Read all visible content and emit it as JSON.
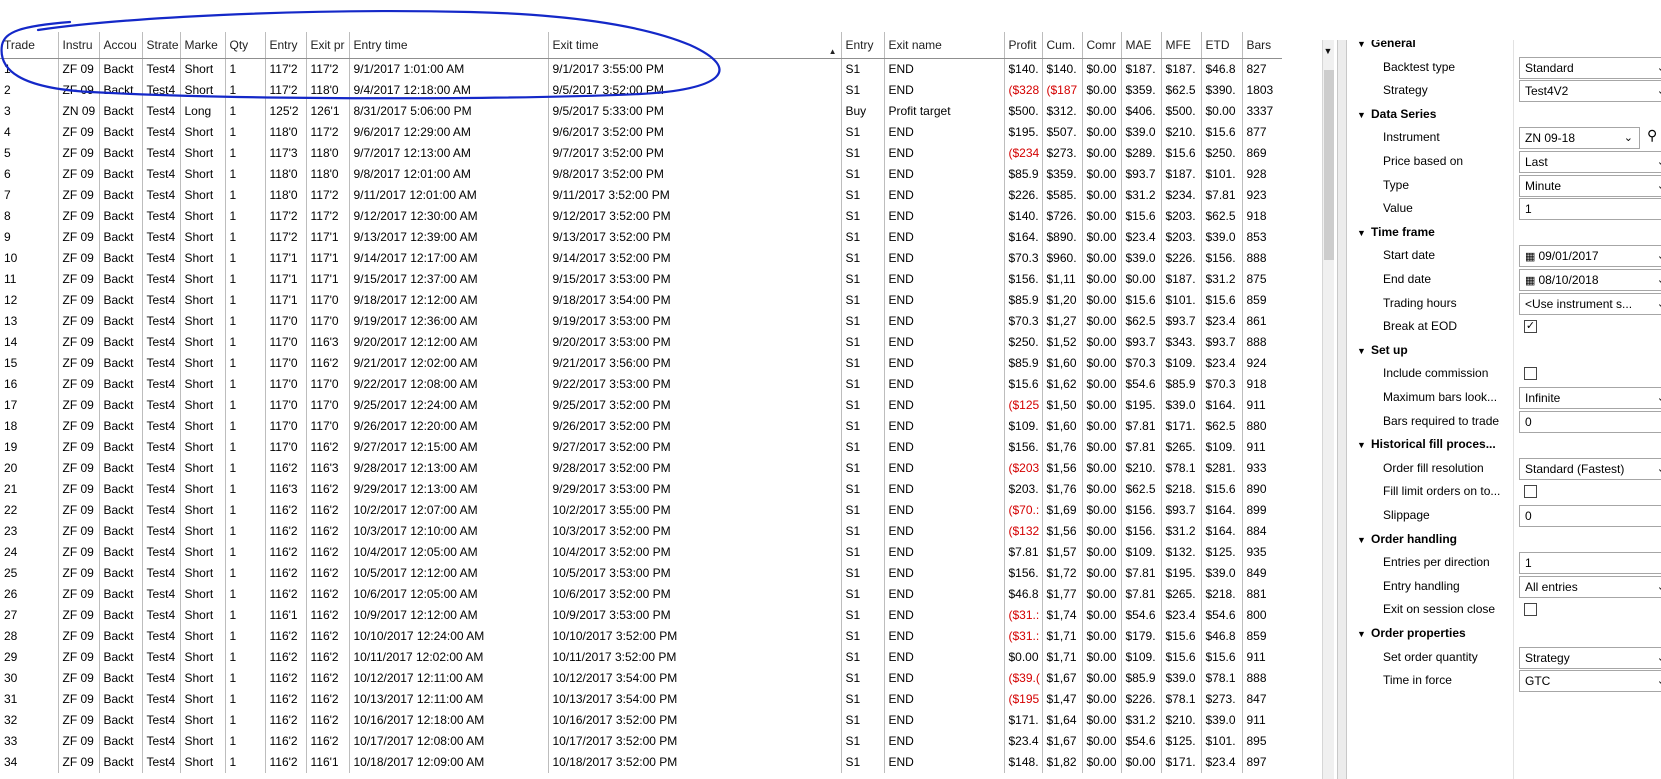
{
  "grid": {
    "columns": [
      {
        "label": "Trade",
        "w": 58
      },
      {
        "label": "Instru",
        "w": 41
      },
      {
        "label": "Accou",
        "w": 43
      },
      {
        "label": "Strate",
        "w": 38
      },
      {
        "label": "Marke",
        "w": 45
      },
      {
        "label": "Qty",
        "w": 40
      },
      {
        "label": "Entry",
        "w": 41
      },
      {
        "label": "Exit pr",
        "w": 43
      },
      {
        "label": "Entry time",
        "w": 199
      },
      {
        "label": "Exit time",
        "w": 293
      },
      {
        "label": "Entry",
        "w": 43
      },
      {
        "label": "Exit name",
        "w": 120
      },
      {
        "label": "Profit",
        "w": 38
      },
      {
        "label": "Cum.",
        "w": 40
      },
      {
        "label": "Comr",
        "w": 39
      },
      {
        "label": "MAE",
        "w": 40
      },
      {
        "label": "MFE",
        "w": 40
      },
      {
        "label": "ETD",
        "w": 41
      },
      {
        "label": "Bars",
        "w": 40
      }
    ],
    "sorted_column_index": 9,
    "sort_arrow": "▲",
    "rows": [
      [
        "1",
        "ZF 09",
        "Backt",
        "Test4",
        "Short",
        "1",
        "117'2",
        "117'2",
        "9/1/2017 1:01:00 AM",
        "9/1/2017 3:55:00 PM",
        "S1",
        "END",
        "$140.",
        "$140.",
        "$0.00",
        "$187.",
        "$187.",
        "$46.8",
        "827"
      ],
      [
        "2",
        "ZF 09",
        "Backt",
        "Test4",
        "Short",
        "1",
        "117'2",
        "118'0",
        "9/4/2017 12:18:00 AM",
        "9/5/2017 3:52:00 PM",
        "S1",
        "END",
        "($328",
        "($187",
        "$0.00",
        "$359.",
        "$62.5",
        "$390.",
        "1803"
      ],
      [
        "3",
        "ZN 09",
        "Backt",
        "Test4",
        "Long",
        "1",
        "125'2",
        "126'1",
        "8/31/2017 5:06:00 PM",
        "9/5/2017 5:33:00 PM",
        "Buy",
        "Profit target",
        "$500.",
        "$312.",
        "$0.00",
        "$406.",
        "$500.",
        "$0.00",
        "3337"
      ],
      [
        "4",
        "ZF 09",
        "Backt",
        "Test4",
        "Short",
        "1",
        "118'0",
        "117'2",
        "9/6/2017 12:29:00 AM",
        "9/6/2017 3:52:00 PM",
        "S1",
        "END",
        "$195.",
        "$507.",
        "$0.00",
        "$39.0",
        "$210.",
        "$15.6",
        "877"
      ],
      [
        "5",
        "ZF 09",
        "Backt",
        "Test4",
        "Short",
        "1",
        "117'3",
        "118'0",
        "9/7/2017 12:13:00 AM",
        "9/7/2017 3:52:00 PM",
        "S1",
        "END",
        "($234",
        "$273.",
        "$0.00",
        "$289.",
        "$15.6",
        "$250.",
        "869"
      ],
      [
        "6",
        "ZF 09",
        "Backt",
        "Test4",
        "Short",
        "1",
        "118'0",
        "118'0",
        "9/8/2017 12:01:00 AM",
        "9/8/2017 3:52:00 PM",
        "S1",
        "END",
        "$85.9",
        "$359.",
        "$0.00",
        "$93.7",
        "$187.",
        "$101.",
        "928"
      ],
      [
        "7",
        "ZF 09",
        "Backt",
        "Test4",
        "Short",
        "1",
        "118'0",
        "117'2",
        "9/11/2017 12:01:00 AM",
        "9/11/2017 3:52:00 PM",
        "S1",
        "END",
        "$226.",
        "$585.",
        "$0.00",
        "$31.2",
        "$234.",
        "$7.81",
        "923"
      ],
      [
        "8",
        "ZF 09",
        "Backt",
        "Test4",
        "Short",
        "1",
        "117'2",
        "117'2",
        "9/12/2017 12:30:00 AM",
        "9/12/2017 3:52:00 PM",
        "S1",
        "END",
        "$140.",
        "$726.",
        "$0.00",
        "$15.6",
        "$203.",
        "$62.5",
        "918"
      ],
      [
        "9",
        "ZF 09",
        "Backt",
        "Test4",
        "Short",
        "1",
        "117'2",
        "117'1",
        "9/13/2017 12:39:00 AM",
        "9/13/2017 3:52:00 PM",
        "S1",
        "END",
        "$164.",
        "$890.",
        "$0.00",
        "$23.4",
        "$203.",
        "$39.0",
        "853"
      ],
      [
        "10",
        "ZF 09",
        "Backt",
        "Test4",
        "Short",
        "1",
        "117'1",
        "117'1",
        "9/14/2017 12:17:00 AM",
        "9/14/2017 3:52:00 PM",
        "S1",
        "END",
        "$70.3",
        "$960.",
        "$0.00",
        "$39.0",
        "$226.",
        "$156.",
        "888"
      ],
      [
        "11",
        "ZF 09",
        "Backt",
        "Test4",
        "Short",
        "1",
        "117'1",
        "117'1",
        "9/15/2017 12:37:00 AM",
        "9/15/2017 3:53:00 PM",
        "S1",
        "END",
        "$156.",
        "$1,11",
        "$0.00",
        "$0.00",
        "$187.",
        "$31.2",
        "875"
      ],
      [
        "12",
        "ZF 09",
        "Backt",
        "Test4",
        "Short",
        "1",
        "117'1",
        "117'0",
        "9/18/2017 12:12:00 AM",
        "9/18/2017 3:54:00 PM",
        "S1",
        "END",
        "$85.9",
        "$1,20",
        "$0.00",
        "$15.6",
        "$101.",
        "$15.6",
        "859"
      ],
      [
        "13",
        "ZF 09",
        "Backt",
        "Test4",
        "Short",
        "1",
        "117'0",
        "117'0",
        "9/19/2017 12:36:00 AM",
        "9/19/2017 3:53:00 PM",
        "S1",
        "END",
        "$70.3",
        "$1,27",
        "$0.00",
        "$62.5",
        "$93.7",
        "$23.4",
        "861"
      ],
      [
        "14",
        "ZF 09",
        "Backt",
        "Test4",
        "Short",
        "1",
        "117'0",
        "116'3",
        "9/20/2017 12:12:00 AM",
        "9/20/2017 3:53:00 PM",
        "S1",
        "END",
        "$250.",
        "$1,52",
        "$0.00",
        "$93.7",
        "$343.",
        "$93.7",
        "888"
      ],
      [
        "15",
        "ZF 09",
        "Backt",
        "Test4",
        "Short",
        "1",
        "117'0",
        "116'2",
        "9/21/2017 12:02:00 AM",
        "9/21/2017 3:56:00 PM",
        "S1",
        "END",
        "$85.9",
        "$1,60",
        "$0.00",
        "$70.3",
        "$109.",
        "$23.4",
        "924"
      ],
      [
        "16",
        "ZF 09",
        "Backt",
        "Test4",
        "Short",
        "1",
        "117'0",
        "117'0",
        "9/22/2017 12:08:00 AM",
        "9/22/2017 3:53:00 PM",
        "S1",
        "END",
        "$15.6",
        "$1,62",
        "$0.00",
        "$54.6",
        "$85.9",
        "$70.3",
        "918"
      ],
      [
        "17",
        "ZF 09",
        "Backt",
        "Test4",
        "Short",
        "1",
        "117'0",
        "117'0",
        "9/25/2017 12:24:00 AM",
        "9/25/2017 3:52:00 PM",
        "S1",
        "END",
        "($125",
        "$1,50",
        "$0.00",
        "$195.",
        "$39.0",
        "$164.",
        "911"
      ],
      [
        "18",
        "ZF 09",
        "Backt",
        "Test4",
        "Short",
        "1",
        "117'0",
        "117'0",
        "9/26/2017 12:20:00 AM",
        "9/26/2017 3:52:00 PM",
        "S1",
        "END",
        "$109.",
        "$1,60",
        "$0.00",
        "$7.81",
        "$171.",
        "$62.5",
        "880"
      ],
      [
        "19",
        "ZF 09",
        "Backt",
        "Test4",
        "Short",
        "1",
        "117'0",
        "116'2",
        "9/27/2017 12:15:00 AM",
        "9/27/2017 3:52:00 PM",
        "S1",
        "END",
        "$156.",
        "$1,76",
        "$0.00",
        "$7.81",
        "$265.",
        "$109.",
        "911"
      ],
      [
        "20",
        "ZF 09",
        "Backt",
        "Test4",
        "Short",
        "1",
        "116'2",
        "116'3",
        "9/28/2017 12:13:00 AM",
        "9/28/2017 3:52:00 PM",
        "S1",
        "END",
        "($203",
        "$1,56",
        "$0.00",
        "$210.",
        "$78.1",
        "$281.",
        "933"
      ],
      [
        "21",
        "ZF 09",
        "Backt",
        "Test4",
        "Short",
        "1",
        "116'3",
        "116'2",
        "9/29/2017 12:13:00 AM",
        "9/29/2017 3:53:00 PM",
        "S1",
        "END",
        "$203.",
        "$1,76",
        "$0.00",
        "$62.5",
        "$218.",
        "$15.6",
        "890"
      ],
      [
        "22",
        "ZF 09",
        "Backt",
        "Test4",
        "Short",
        "1",
        "116'2",
        "116'2",
        "10/2/2017 12:07:00 AM",
        "10/2/2017 3:55:00 PM",
        "S1",
        "END",
        "($70.:",
        "$1,69",
        "$0.00",
        "$156.",
        "$93.7",
        "$164.",
        "899"
      ],
      [
        "23",
        "ZF 09",
        "Backt",
        "Test4",
        "Short",
        "1",
        "116'2",
        "116'2",
        "10/3/2017 12:10:00 AM",
        "10/3/2017 3:52:00 PM",
        "S1",
        "END",
        "($132",
        "$1,56",
        "$0.00",
        "$156.",
        "$31.2",
        "$164.",
        "884"
      ],
      [
        "24",
        "ZF 09",
        "Backt",
        "Test4",
        "Short",
        "1",
        "116'2",
        "116'2",
        "10/4/2017 12:05:00 AM",
        "10/4/2017 3:52:00 PM",
        "S1",
        "END",
        "$7.81",
        "$1,57",
        "$0.00",
        "$109.",
        "$132.",
        "$125.",
        "935"
      ],
      [
        "25",
        "ZF 09",
        "Backt",
        "Test4",
        "Short",
        "1",
        "116'2",
        "116'2",
        "10/5/2017 12:12:00 AM",
        "10/5/2017 3:53:00 PM",
        "S1",
        "END",
        "$156.",
        "$1,72",
        "$0.00",
        "$7.81",
        "$195.",
        "$39.0",
        "849"
      ],
      [
        "26",
        "ZF 09",
        "Backt",
        "Test4",
        "Short",
        "1",
        "116'2",
        "116'2",
        "10/6/2017 12:05:00 AM",
        "10/6/2017 3:52:00 PM",
        "S1",
        "END",
        "$46.8",
        "$1,77",
        "$0.00",
        "$7.81",
        "$265.",
        "$218.",
        "881"
      ],
      [
        "27",
        "ZF 09",
        "Backt",
        "Test4",
        "Short",
        "1",
        "116'1",
        "116'2",
        "10/9/2017 12:12:00 AM",
        "10/9/2017 3:53:00 PM",
        "S1",
        "END",
        "($31.:",
        "$1,74",
        "$0.00",
        "$54.6",
        "$23.4",
        "$54.6",
        "800"
      ],
      [
        "28",
        "ZF 09",
        "Backt",
        "Test4",
        "Short",
        "1",
        "116'2",
        "116'2",
        "10/10/2017 12:24:00 AM",
        "10/10/2017 3:52:00 PM",
        "S1",
        "END",
        "($31.:",
        "$1,71",
        "$0.00",
        "$179.",
        "$15.6",
        "$46.8",
        "859"
      ],
      [
        "29",
        "ZF 09",
        "Backt",
        "Test4",
        "Short",
        "1",
        "116'2",
        "116'2",
        "10/11/2017 12:02:00 AM",
        "10/11/2017 3:52:00 PM",
        "S1",
        "END",
        "$0.00",
        "$1,71",
        "$0.00",
        "$109.",
        "$15.6",
        "$15.6",
        "911"
      ],
      [
        "30",
        "ZF 09",
        "Backt",
        "Test4",
        "Short",
        "1",
        "116'2",
        "116'2",
        "10/12/2017 12:11:00 AM",
        "10/12/2017 3:54:00 PM",
        "S1",
        "END",
        "($39.(",
        "$1,67",
        "$0.00",
        "$85.9",
        "$39.0",
        "$78.1",
        "888"
      ],
      [
        "31",
        "ZF 09",
        "Backt",
        "Test4",
        "Short",
        "1",
        "116'2",
        "116'2",
        "10/13/2017 12:11:00 AM",
        "10/13/2017 3:54:00 PM",
        "S1",
        "END",
        "($195",
        "$1,47",
        "$0.00",
        "$226.",
        "$78.1",
        "$273.",
        "847"
      ],
      [
        "32",
        "ZF 09",
        "Backt",
        "Test4",
        "Short",
        "1",
        "116'2",
        "116'2",
        "10/16/2017 12:18:00 AM",
        "10/16/2017 3:52:00 PM",
        "S1",
        "END",
        "$171.",
        "$1,64",
        "$0.00",
        "$31.2",
        "$210.",
        "$39.0",
        "911"
      ],
      [
        "33",
        "ZF 09",
        "Backt",
        "Test4",
        "Short",
        "1",
        "116'2",
        "116'2",
        "10/17/2017 12:08:00 AM",
        "10/17/2017 3:52:00 PM",
        "S1",
        "END",
        "$23.4",
        "$1,67",
        "$0.00",
        "$54.6",
        "$125.",
        "$101.",
        "895"
      ],
      [
        "34",
        "ZF 09",
        "Backt",
        "Test4",
        "Short",
        "1",
        "116'2",
        "116'1",
        "10/18/2017 12:09:00 AM",
        "10/18/2017 3:52:00 PM",
        "S1",
        "END",
        "$148.",
        "$1,82",
        "$0.00",
        "$0.00",
        "$171.",
        "$23.4",
        "897"
      ]
    ]
  },
  "panel": {
    "collapse_glyph": "▼",
    "sections": [
      {
        "title": "General",
        "items": [
          {
            "label": "Backtest type",
            "type": "dropdown",
            "value": "Standard"
          },
          {
            "label": "Strategy",
            "type": "dropdown",
            "value": "Test4V2"
          }
        ]
      },
      {
        "title": "Data Series",
        "items": [
          {
            "label": "Instrument",
            "type": "instrument",
            "value": "ZN 09-18"
          },
          {
            "label": "Price based on",
            "type": "dropdown",
            "value": "Last"
          },
          {
            "label": "Type",
            "type": "dropdown",
            "value": "Minute"
          },
          {
            "label": "Value",
            "type": "text",
            "value": "1"
          }
        ]
      },
      {
        "title": "Time frame",
        "items": [
          {
            "label": "Start date",
            "type": "date",
            "value": "09/01/2017"
          },
          {
            "label": "End date",
            "type": "date",
            "value": "08/10/2018"
          },
          {
            "label": "Trading hours",
            "type": "dropdown",
            "value": "<Use instrument s..."
          },
          {
            "label": "Break at EOD",
            "type": "checkbox",
            "checked": true
          }
        ]
      },
      {
        "title": "Set up",
        "items": [
          {
            "label": "Include commission",
            "type": "checkbox",
            "checked": false
          },
          {
            "label": "Maximum bars look...",
            "type": "dropdown",
            "value": "Infinite"
          },
          {
            "label": "Bars required to trade",
            "type": "text",
            "value": "0"
          }
        ]
      },
      {
        "title": "Historical fill proces...",
        "items": [
          {
            "label": "Order fill resolution",
            "type": "dropdown",
            "value": "Standard (Fastest)"
          },
          {
            "label": "Fill limit orders on to...",
            "type": "checkbox",
            "checked": false
          },
          {
            "label": "Slippage",
            "type": "text",
            "value": "0"
          }
        ]
      },
      {
        "title": "Order handling",
        "items": [
          {
            "label": "Entries per direction",
            "type": "text",
            "value": "1"
          },
          {
            "label": "Entry handling",
            "type": "dropdown",
            "value": "All entries"
          },
          {
            "label": "Exit on session close",
            "type": "checkbox",
            "checked": false
          }
        ]
      },
      {
        "title": "Order properties",
        "items": [
          {
            "label": "Set order quantity",
            "type": "dropdown",
            "value": "Strategy"
          },
          {
            "label": "Time in force",
            "type": "dropdown",
            "value": "GTC"
          }
        ]
      }
    ]
  },
  "colors": {
    "negative": "#d40000",
    "annotation": "#1428c8"
  },
  "icons": {
    "dropdown": "chevron-down-icon",
    "date": "calendar-icon",
    "instrument_search": "magnifier-icon",
    "section": "collapse-triangle-icon",
    "checkbox": "checkmark-icon"
  }
}
